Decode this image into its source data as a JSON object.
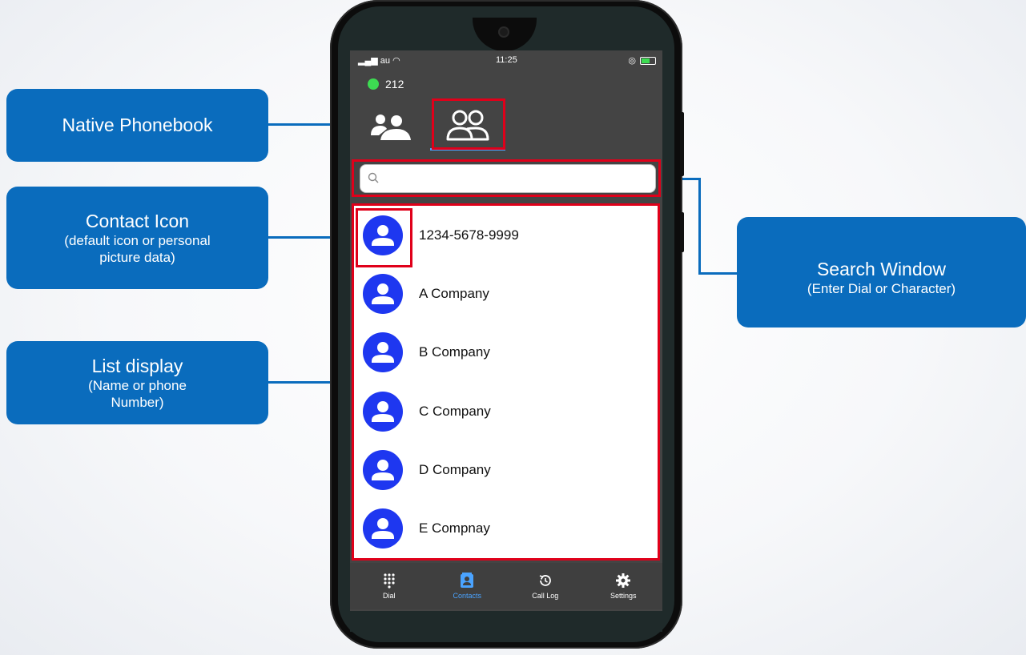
{
  "callouts": {
    "native_phonebook": {
      "title": "Native Phonebook"
    },
    "contact_icon": {
      "title": "Contact Icon",
      "subtitle": "(default icon or personal picture data)"
    },
    "list_display": {
      "title": "List display",
      "subtitle": "(Name or phone Number)"
    },
    "search_window": {
      "title": "Search Window",
      "subtitle": "(Enter Dial or Character)"
    }
  },
  "status_bar": {
    "carrier": "au",
    "time": "11:25"
  },
  "extension": {
    "number": "212",
    "status_color": "#3ddc52"
  },
  "tabs": [
    {
      "icon": "native-phonebook-icon"
    },
    {
      "icon": "contacts-group-icon",
      "active": true
    }
  ],
  "search": {
    "placeholder": "",
    "value": ""
  },
  "contacts": [
    {
      "name": "1234-5678-9999"
    },
    {
      "name": "A Company"
    },
    {
      "name": "B Company"
    },
    {
      "name": "C Company"
    },
    {
      "name": "D Company"
    },
    {
      "name": "E Compnay"
    }
  ],
  "bottom_nav": [
    {
      "label": "Dial",
      "icon": "dialpad-icon"
    },
    {
      "label": "Contacts",
      "icon": "contacts-icon",
      "active": true
    },
    {
      "label": "Call Log",
      "icon": "history-icon"
    },
    {
      "label": "Settings",
      "icon": "gear-icon"
    }
  ],
  "colors": {
    "callout": "#0a6cbd",
    "highlight": "#e0001a",
    "avatar": "#1e37f0",
    "active": "#4aa3ff"
  }
}
